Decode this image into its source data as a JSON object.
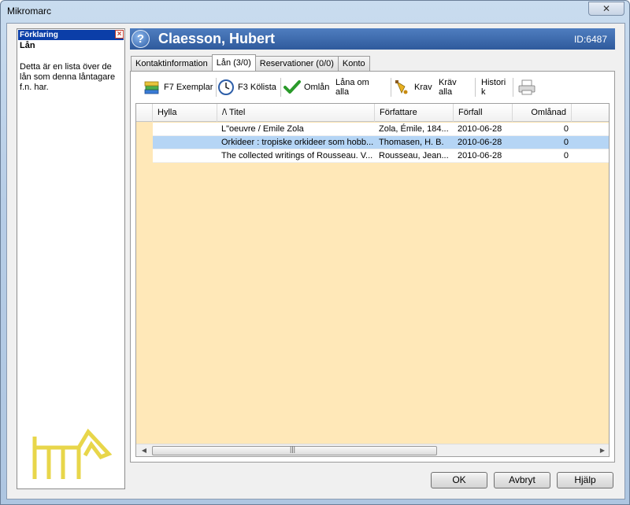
{
  "window": {
    "title": "Mikromarc"
  },
  "explanation": {
    "header": "Förklaring",
    "title": "Lån",
    "text": "Detta är en lista över de lån som denna låntagare f.n. har."
  },
  "patron": {
    "name": "Claesson, Hubert",
    "id_label": "ID:6487"
  },
  "tabs": [
    {
      "label": "Kontaktinformation"
    },
    {
      "label": "Lån (3/0)"
    },
    {
      "label": "Reservationer (0/0)"
    },
    {
      "label": "Konto"
    }
  ],
  "toolbar": {
    "exemplar": "F7 Exemplar",
    "kolista": "F3 Kölista",
    "omlan": "Omlån",
    "lana_om_alla_1": "Låna om",
    "lana_om_alla_2": "alla",
    "krav": "Krav",
    "krav_alla_1": "Kräv",
    "krav_alla_2": "alla",
    "historik_1": "Histori",
    "historik_2": "k"
  },
  "columns": {
    "hylla": "Hylla",
    "titel": "/\\ Titel",
    "forfattare": "Författare",
    "forfall": "Förfall",
    "omlanad": "Omlånad"
  },
  "loans": [
    {
      "hylla": "",
      "titel": "L\"oeuvre / Emile Zola",
      "forfattare": "Zola, Émile, 184...",
      "forfall": "2010-06-28",
      "omlanad": "0"
    },
    {
      "hylla": "",
      "titel": "Orkideer : tropiske orkideer som hobb...",
      "forfattare": "Thomasen, H. B.",
      "forfall": "2010-06-28",
      "omlanad": "0"
    },
    {
      "hylla": "",
      "titel": "The collected writings of Rousseau. V...",
      "forfattare": "Rousseau, Jean...",
      "forfall": "2010-06-28",
      "omlanad": "0"
    }
  ],
  "buttons": {
    "ok": "OK",
    "cancel": "Avbryt",
    "help": "Hjälp"
  },
  "colors": {
    "header_blue": "#2f5a9c",
    "grid_background": "#ffe8b8",
    "selection": "#b5d5f5"
  }
}
